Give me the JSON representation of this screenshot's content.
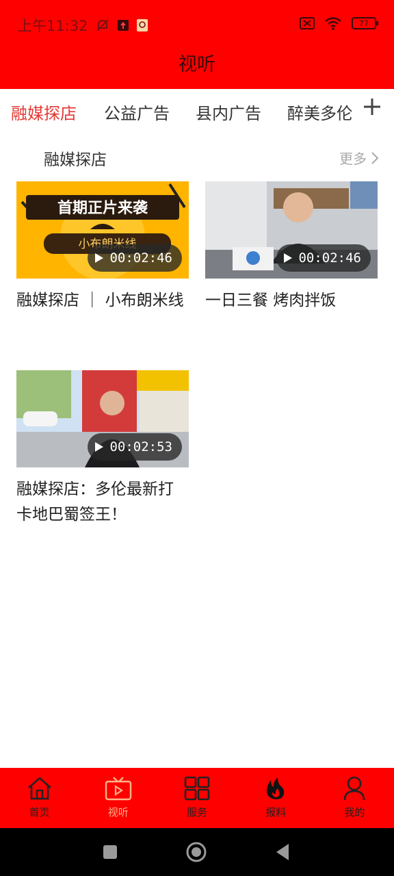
{
  "status_bar": {
    "time": "上午11:32",
    "battery": "77"
  },
  "header": {
    "title": "视听"
  },
  "tabs": [
    {
      "label": "融媒探店",
      "active": true
    },
    {
      "label": "公益广告",
      "active": false
    },
    {
      "label": "县内广告",
      "active": false
    },
    {
      "label": "醉美多伦",
      "active": false
    }
  ],
  "section": {
    "title": "融媒探店",
    "more_label": "更多"
  },
  "videos": [
    {
      "title": "融媒探店 ｜ 小布朗米线",
      "duration": "00:02:46",
      "thumb_text_top": "首期正片来袭",
      "thumb_text_bottom": "小布朗米线"
    },
    {
      "title": "一日三餐  烤肉拌饭",
      "duration": "00:02:46"
    },
    {
      "title": "融媒探店：多伦最新打卡地巴蜀签王！",
      "duration": "00:02:53"
    }
  ],
  "bottom_nav": [
    {
      "label": "首页",
      "icon": "home-icon",
      "active": false
    },
    {
      "label": "视听",
      "icon": "tv-play-icon",
      "active": true
    },
    {
      "label": "服务",
      "icon": "grid-icon",
      "active": false
    },
    {
      "label": "报料",
      "icon": "fire-icon",
      "active": false
    },
    {
      "label": "我的",
      "icon": "person-icon",
      "active": false
    }
  ],
  "colors": {
    "brand_red": "#ff0000",
    "tab_active": "#e53935",
    "nav_active": "#ffb38a"
  }
}
